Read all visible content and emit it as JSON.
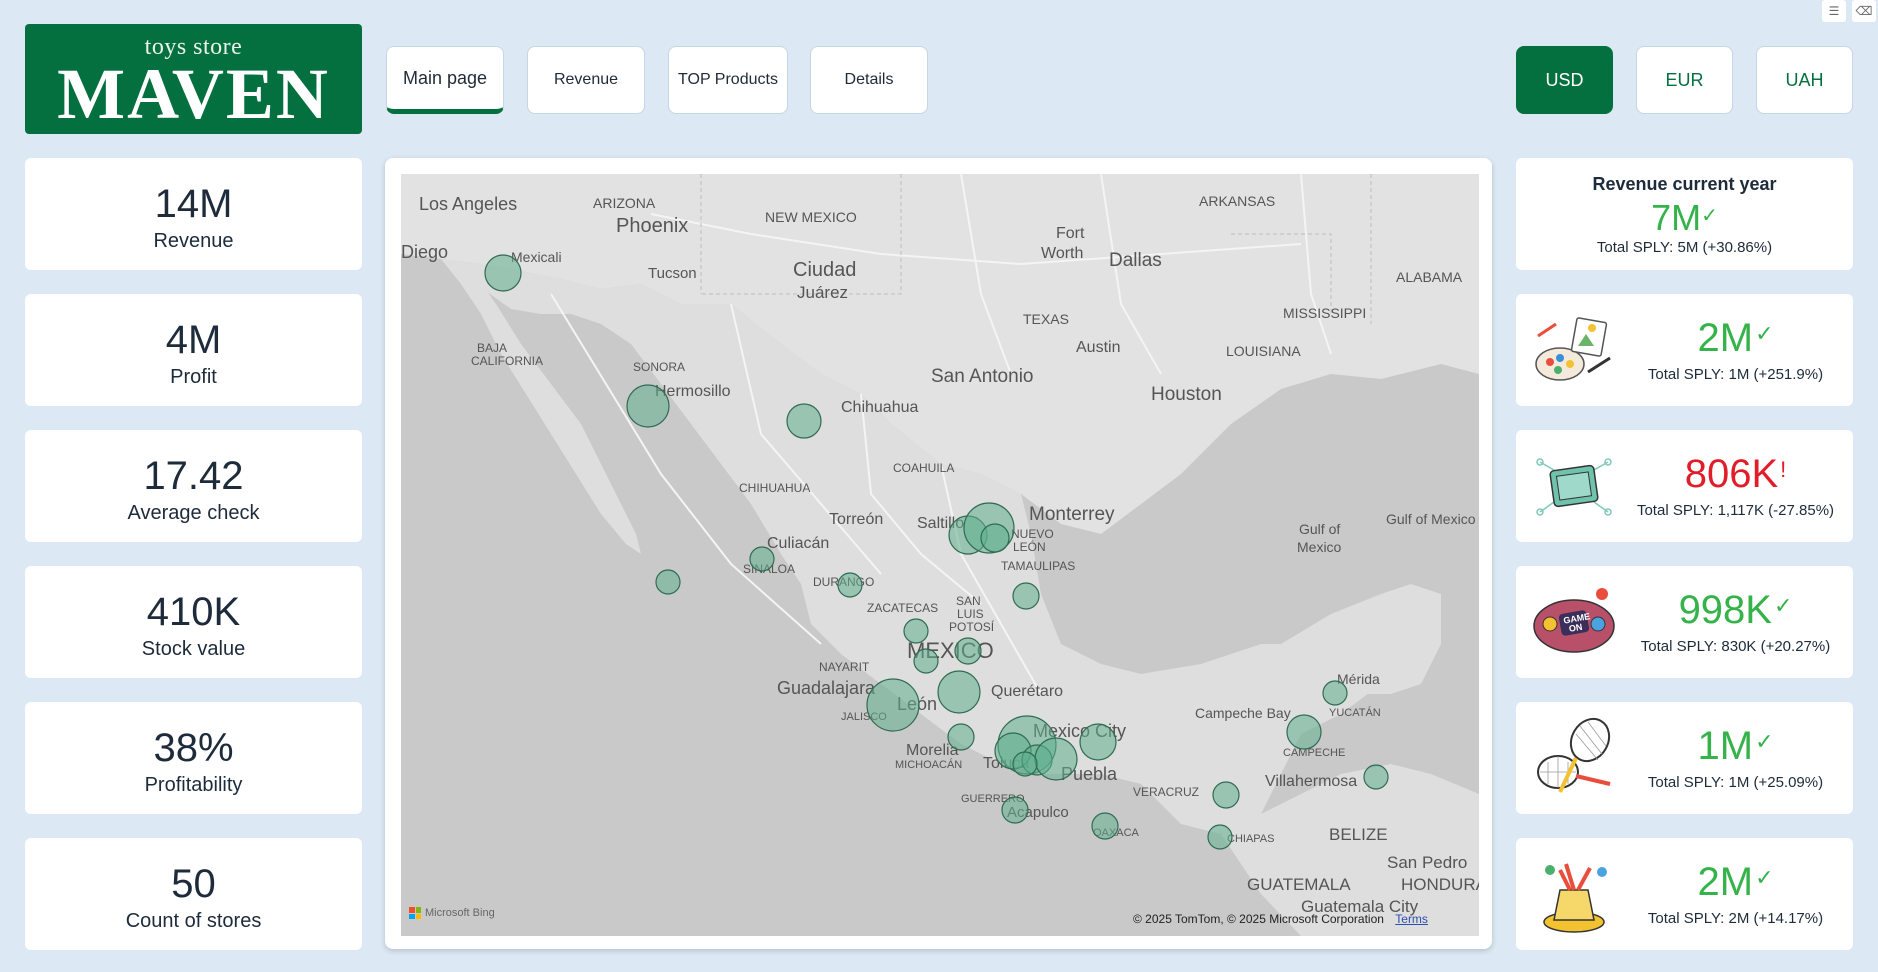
{
  "logo": {
    "sub": "toys store",
    "main": "MAVEN"
  },
  "nav": [
    "Main page",
    "Revenue",
    "TOP Products",
    "Details"
  ],
  "currency": [
    "USD",
    "EUR",
    "UAH"
  ],
  "kpis": [
    {
      "value": "14M",
      "label": "Revenue"
    },
    {
      "value": "4M",
      "label": "Profit"
    },
    {
      "value": "17.42",
      "label": "Average check"
    },
    {
      "value": "410K",
      "label": "Stock value"
    },
    {
      "value": "38%",
      "label": "Profitability"
    },
    {
      "value": "50",
      "label": "Count of stores"
    }
  ],
  "revenue_current": {
    "title": "Revenue current year",
    "value": "7M",
    "mark": "✓",
    "sply": "Total SPLY: 5M (+30.86%)"
  },
  "categories": [
    {
      "icon": "art-crafts-icon",
      "value": "2M",
      "mark": "✓",
      "status": "up",
      "sply": "Total SPLY: 1M (+251.9%)"
    },
    {
      "icon": "electronics-icon",
      "value": "806K",
      "mark": "!",
      "status": "down",
      "sply": "Total SPLY: 1,117K (-27.85%)"
    },
    {
      "icon": "games-icon",
      "value": "998K",
      "mark": "✓",
      "status": "up",
      "sply": "Total SPLY: 830K (+20.27%)"
    },
    {
      "icon": "sports-outdoors-icon",
      "value": "1M",
      "mark": "✓",
      "status": "up",
      "sply": "Total SPLY: 1M (+25.09%)"
    },
    {
      "icon": "toys-icon",
      "value": "2M",
      "mark": "✓",
      "status": "up",
      "sply": "Total SPLY: 2M (+14.17%)"
    }
  ],
  "map": {
    "labels": [
      "Los Angeles",
      "Diego",
      "Mexicali",
      "ARIZONA",
      "Phoenix",
      "Tucson",
      "NEW MEXICO",
      "Ciudad",
      "Juárez",
      "Fort",
      "Worth",
      "Dallas",
      "ARKANSAS",
      "ALABAMA",
      "MISSISSIPPI",
      "LOUISIANA",
      "TEXAS",
      "Austin",
      "San Antonio",
      "Houston",
      "BAJA",
      "CALIFORNIA",
      "SONORA",
      "Hermosillo",
      "Chihuahua",
      "COAHUILA",
      "CHIHUAHUA",
      "Torreón",
      "Saltillo",
      "Monterrey",
      "NUEVO",
      "LEÓN",
      "TAMAULIPAS",
      "Culiacán",
      "SINALOA",
      "DURANGO",
      "ZACATECAS",
      "SAN",
      "LUIS",
      "POTOSÍ",
      "MEXICO",
      "NAYARIT",
      "Guadalajara",
      "León",
      "JALISCO",
      "Querétaro",
      "Morelia",
      "MICHOACÁN",
      "Toluca",
      "Mexico City",
      "Puebla",
      "GUERRERO",
      "Acapulco",
      "OAXACA",
      "VERACRUZ",
      "CHIAPAS",
      "Villahermosa",
      "CAMPECHE",
      "Campeche Bay",
      "Mérida",
      "YUCATÁN",
      "Gulf of",
      "Mexico",
      "Gulf of Mexico",
      "BELIZE",
      "GUATEMALA",
      "Guatemala City",
      "San Pedro",
      "HONDURAS"
    ],
    "credit": "© 2025 TomTom, © 2025 Microsoft Corporation",
    "terms": "Terms",
    "provider": "Microsoft Bing"
  },
  "colors": {
    "brand": "#05703f",
    "up": "#35b34a",
    "down": "#e11d2a",
    "bubble": "#5fae8c"
  }
}
